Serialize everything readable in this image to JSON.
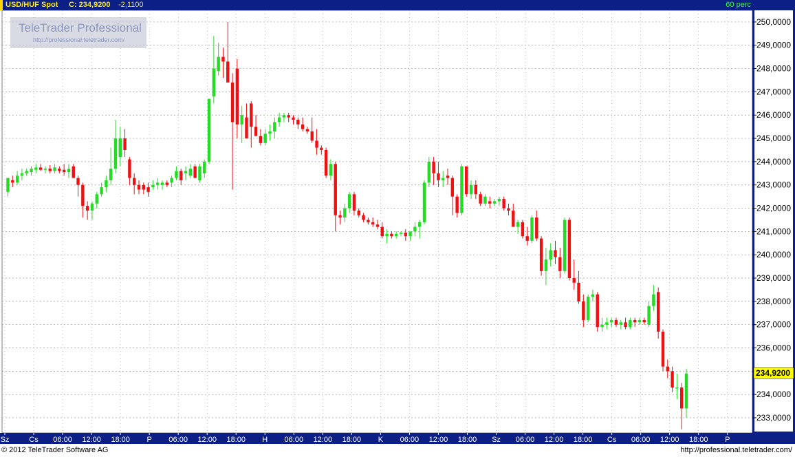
{
  "header": {
    "symbol": "USD/HUF Spot",
    "close_label": "C: 234,9200",
    "change": "-2,1100",
    "period": "60 perc"
  },
  "logo": {
    "brand": "TeleTrader Professional",
    "url": "http://professional.teletrader.com/"
  },
  "footer": {
    "copyright": "© 2012 TeleTrader Software AG",
    "url": "http://professional.teletrader.com/"
  },
  "colors": {
    "up": "#22dd22",
    "down": "#ee1111",
    "grid": "#9a9a9a",
    "header_bg": "#0b1f86",
    "axis_bg": "#0b1f86",
    "price_marker": "#ffff00"
  },
  "chart_data": {
    "type": "candlestick",
    "title": "USD/HUF Spot",
    "ylim": [
      232.35,
      250.5
    ],
    "y_ticks": [
      "233,0000",
      "234,0000",
      "235,0000",
      "236,0000",
      "237,0000",
      "238,0000",
      "239,0000",
      "240,0000",
      "241,0000",
      "242,0000",
      "243,0000",
      "244,0000",
      "245,0000",
      "246,0000",
      "247,0000",
      "248,0000",
      "249,0000",
      "250,0000"
    ],
    "last_price_label": "234,9200",
    "last_price": 234.92,
    "x_ticks": [
      "Sz",
      "Cs",
      "06:00",
      "12:00",
      "18:00",
      "P",
      "06:00",
      "12:00",
      "18:00",
      "H",
      "06:00",
      "12:00",
      "18:00",
      "K",
      "06:00",
      "12:00",
      "18:00",
      "Sz",
      "06:00",
      "12:00",
      "18:00",
      "Cs",
      "06:00",
      "12:00",
      "18:00",
      "P"
    ],
    "grid": true,
    "candles": [
      {
        "o": 242.7,
        "h": 243.3,
        "l": 242.5,
        "c": 243.3
      },
      {
        "o": 243.2,
        "h": 243.4,
        "l": 242.9,
        "c": 243.1
      },
      {
        "o": 243.1,
        "h": 243.6,
        "l": 243.0,
        "c": 243.4
      },
      {
        "o": 243.4,
        "h": 243.7,
        "l": 243.2,
        "c": 243.5
      },
      {
        "o": 243.5,
        "h": 243.7,
        "l": 243.4,
        "c": 243.6
      },
      {
        "o": 243.55,
        "h": 243.8,
        "l": 243.4,
        "c": 243.7
      },
      {
        "o": 243.65,
        "h": 243.9,
        "l": 243.5,
        "c": 243.75
      },
      {
        "o": 243.75,
        "h": 243.9,
        "l": 243.6,
        "c": 243.65
      },
      {
        "o": 243.65,
        "h": 243.8,
        "l": 243.5,
        "c": 243.7
      },
      {
        "o": 243.7,
        "h": 243.85,
        "l": 243.5,
        "c": 243.6
      },
      {
        "o": 243.6,
        "h": 243.9,
        "l": 243.5,
        "c": 243.75
      },
      {
        "o": 243.7,
        "h": 243.8,
        "l": 243.5,
        "c": 243.6
      },
      {
        "o": 243.65,
        "h": 243.9,
        "l": 243.4,
        "c": 243.55
      },
      {
        "o": 243.55,
        "h": 243.9,
        "l": 243.3,
        "c": 243.7
      },
      {
        "o": 243.8,
        "h": 243.9,
        "l": 243.3,
        "c": 243.3
      },
      {
        "o": 243.3,
        "h": 243.4,
        "l": 242.5,
        "c": 243.0
      },
      {
        "o": 243.0,
        "h": 243.1,
        "l": 241.6,
        "c": 242.1
      },
      {
        "o": 242.1,
        "h": 242.3,
        "l": 241.5,
        "c": 241.9
      },
      {
        "o": 241.9,
        "h": 242.3,
        "l": 241.5,
        "c": 242.2
      },
      {
        "o": 242.2,
        "h": 242.7,
        "l": 242.0,
        "c": 242.6
      },
      {
        "o": 242.6,
        "h": 243.1,
        "l": 242.5,
        "c": 242.9
      },
      {
        "o": 242.9,
        "h": 243.4,
        "l": 242.7,
        "c": 243.2
      },
      {
        "o": 243.2,
        "h": 244.6,
        "l": 243.0,
        "c": 243.7
      },
      {
        "o": 243.7,
        "h": 245.8,
        "l": 243.5,
        "c": 245.0
      },
      {
        "o": 244.2,
        "h": 245.5,
        "l": 243.8,
        "c": 245.0
      },
      {
        "o": 245.0,
        "h": 245.4,
        "l": 244.2,
        "c": 244.5
      },
      {
        "o": 244.1,
        "h": 244.2,
        "l": 243.0,
        "c": 243.3
      },
      {
        "o": 243.3,
        "h": 243.5,
        "l": 242.6,
        "c": 243.0
      },
      {
        "o": 243.0,
        "h": 243.2,
        "l": 242.6,
        "c": 242.8
      },
      {
        "o": 243.0,
        "h": 243.1,
        "l": 242.6,
        "c": 242.8
      },
      {
        "o": 242.9,
        "h": 243.1,
        "l": 242.5,
        "c": 242.7
      },
      {
        "o": 242.9,
        "h": 243.2,
        "l": 242.8,
        "c": 243.0
      },
      {
        "o": 243.0,
        "h": 243.3,
        "l": 242.8,
        "c": 243.1
      },
      {
        "o": 243.0,
        "h": 243.2,
        "l": 242.8,
        "c": 243.1
      },
      {
        "o": 243.1,
        "h": 243.2,
        "l": 242.9,
        "c": 243.0
      },
      {
        "o": 243.1,
        "h": 243.4,
        "l": 242.9,
        "c": 243.3
      },
      {
        "o": 243.3,
        "h": 243.8,
        "l": 243.2,
        "c": 243.6
      },
      {
        "o": 243.6,
        "h": 243.7,
        "l": 243.0,
        "c": 243.2
      },
      {
        "o": 243.5,
        "h": 243.8,
        "l": 243.2,
        "c": 243.6
      },
      {
        "o": 243.4,
        "h": 243.9,
        "l": 243.3,
        "c": 243.7
      },
      {
        "o": 243.8,
        "h": 243.9,
        "l": 243.3,
        "c": 243.3
      },
      {
        "o": 243.2,
        "h": 243.9,
        "l": 243.1,
        "c": 243.8
      },
      {
        "o": 243.5,
        "h": 244.1,
        "l": 243.3,
        "c": 244.0
      },
      {
        "o": 244.0,
        "h": 246.7,
        "l": 243.9,
        "c": 246.7
      },
      {
        "o": 246.8,
        "h": 249.4,
        "l": 246.5,
        "c": 248.0
      },
      {
        "o": 247.9,
        "h": 249.1,
        "l": 247.7,
        "c": 248.5
      },
      {
        "o": 248.5,
        "h": 248.9,
        "l": 247.6,
        "c": 248.3
      },
      {
        "o": 248.3,
        "h": 250.0,
        "l": 247.5,
        "c": 247.4
      },
      {
        "o": 247.4,
        "h": 247.8,
        "l": 242.8,
        "c": 245.7
      },
      {
        "o": 248.0,
        "h": 248.4,
        "l": 245.0,
        "c": 245.6
      },
      {
        "o": 245.6,
        "h": 246.4,
        "l": 244.8,
        "c": 246.0
      },
      {
        "o": 245.9,
        "h": 246.5,
        "l": 245.1,
        "c": 245.0
      },
      {
        "o": 246.5,
        "h": 246.6,
        "l": 244.6,
        "c": 245.5
      },
      {
        "o": 245.5,
        "h": 246.0,
        "l": 245.3,
        "c": 245.1
      },
      {
        "o": 245.1,
        "h": 245.4,
        "l": 244.7,
        "c": 244.8
      },
      {
        "o": 244.8,
        "h": 245.4,
        "l": 244.7,
        "c": 245.2
      },
      {
        "o": 245.2,
        "h": 245.6,
        "l": 244.9,
        "c": 245.3
      },
      {
        "o": 245.3,
        "h": 245.9,
        "l": 245.0,
        "c": 245.7
      },
      {
        "o": 245.7,
        "h": 246.1,
        "l": 245.5,
        "c": 245.9
      },
      {
        "o": 245.9,
        "h": 246.1,
        "l": 245.7,
        "c": 246.0
      },
      {
        "o": 246.0,
        "h": 246.1,
        "l": 245.7,
        "c": 245.9
      },
      {
        "o": 245.9,
        "h": 246.0,
        "l": 245.6,
        "c": 245.8
      },
      {
        "o": 245.8,
        "h": 245.9,
        "l": 245.4,
        "c": 245.6
      },
      {
        "o": 245.6,
        "h": 245.9,
        "l": 245.3,
        "c": 245.4
      },
      {
        "o": 245.4,
        "h": 245.5,
        "l": 245.2,
        "c": 245.3
      },
      {
        "o": 245.3,
        "h": 245.9,
        "l": 244.8,
        "c": 244.9
      },
      {
        "o": 244.9,
        "h": 245.4,
        "l": 244.3,
        "c": 244.6
      },
      {
        "o": 244.6,
        "h": 244.7,
        "l": 244.3,
        "c": 244.5
      },
      {
        "o": 244.5,
        "h": 244.6,
        "l": 243.3,
        "c": 243.4
      },
      {
        "o": 243.4,
        "h": 244.1,
        "l": 243.2,
        "c": 243.9
      },
      {
        "o": 243.9,
        "h": 244.0,
        "l": 241.0,
        "c": 241.7
      },
      {
        "o": 241.7,
        "h": 241.9,
        "l": 241.3,
        "c": 241.6
      },
      {
        "o": 241.6,
        "h": 242.2,
        "l": 241.4,
        "c": 242.0
      },
      {
        "o": 242.0,
        "h": 242.7,
        "l": 241.8,
        "c": 242.6
      },
      {
        "o": 242.6,
        "h": 242.7,
        "l": 241.7,
        "c": 241.9
      },
      {
        "o": 241.9,
        "h": 242.0,
        "l": 241.6,
        "c": 241.7
      },
      {
        "o": 241.7,
        "h": 241.8,
        "l": 241.4,
        "c": 241.5
      },
      {
        "o": 241.5,
        "h": 241.6,
        "l": 241.3,
        "c": 241.4
      },
      {
        "o": 241.4,
        "h": 241.6,
        "l": 241.2,
        "c": 241.3
      },
      {
        "o": 241.3,
        "h": 241.5,
        "l": 241.1,
        "c": 241.2
      },
      {
        "o": 241.2,
        "h": 241.4,
        "l": 240.7,
        "c": 240.8
      },
      {
        "o": 240.8,
        "h": 241.1,
        "l": 240.5,
        "c": 240.9
      },
      {
        "o": 240.9,
        "h": 241.0,
        "l": 240.7,
        "c": 240.8
      },
      {
        "o": 240.8,
        "h": 241.0,
        "l": 240.7,
        "c": 240.9
      },
      {
        "o": 240.9,
        "h": 241.0,
        "l": 240.8,
        "c": 240.95
      },
      {
        "o": 240.95,
        "h": 241.1,
        "l": 240.6,
        "c": 240.8
      },
      {
        "o": 240.8,
        "h": 241.0,
        "l": 240.6,
        "c": 241.0
      },
      {
        "o": 241.0,
        "h": 241.4,
        "l": 240.8,
        "c": 241.2
      },
      {
        "o": 241.2,
        "h": 241.5,
        "l": 240.7,
        "c": 241.4
      },
      {
        "o": 241.4,
        "h": 243.2,
        "l": 241.3,
        "c": 243.1
      },
      {
        "o": 243.1,
        "h": 244.2,
        "l": 242.9,
        "c": 244.0
      },
      {
        "o": 244.0,
        "h": 244.2,
        "l": 243.0,
        "c": 243.5
      },
      {
        "o": 243.5,
        "h": 244.0,
        "l": 242.9,
        "c": 243.2
      },
      {
        "o": 243.2,
        "h": 243.6,
        "l": 242.9,
        "c": 243.3
      },
      {
        "o": 243.4,
        "h": 243.7,
        "l": 243.0,
        "c": 243.3
      },
      {
        "o": 243.3,
        "h": 243.4,
        "l": 241.7,
        "c": 242.5
      },
      {
        "o": 242.5,
        "h": 242.6,
        "l": 241.6,
        "c": 241.8
      },
      {
        "o": 241.8,
        "h": 243.9,
        "l": 241.7,
        "c": 243.8
      },
      {
        "o": 243.8,
        "h": 243.8,
        "l": 242.5,
        "c": 242.6
      },
      {
        "o": 242.6,
        "h": 243.2,
        "l": 242.4,
        "c": 243.0
      },
      {
        "o": 243.0,
        "h": 243.2,
        "l": 242.4,
        "c": 242.6
      },
      {
        "o": 242.6,
        "h": 242.7,
        "l": 242.1,
        "c": 242.2
      },
      {
        "o": 242.2,
        "h": 242.6,
        "l": 242.1,
        "c": 242.5
      },
      {
        "o": 242.3,
        "h": 242.5,
        "l": 242.0,
        "c": 242.2
      },
      {
        "o": 242.2,
        "h": 242.4,
        "l": 242.1,
        "c": 242.3
      },
      {
        "o": 242.3,
        "h": 242.5,
        "l": 242.1,
        "c": 242.4
      },
      {
        "o": 242.4,
        "h": 242.5,
        "l": 241.9,
        "c": 242.0
      },
      {
        "o": 242.0,
        "h": 242.2,
        "l": 241.7,
        "c": 241.9
      },
      {
        "o": 241.9,
        "h": 242.2,
        "l": 241.2,
        "c": 241.2
      },
      {
        "o": 241.2,
        "h": 241.5,
        "l": 240.9,
        "c": 241.4
      },
      {
        "o": 241.4,
        "h": 241.5,
        "l": 240.7,
        "c": 240.8
      },
      {
        "o": 240.8,
        "h": 241.2,
        "l": 240.4,
        "c": 240.6
      },
      {
        "o": 240.6,
        "h": 241.7,
        "l": 240.5,
        "c": 241.6
      },
      {
        "o": 241.6,
        "h": 241.9,
        "l": 240.6,
        "c": 240.7
      },
      {
        "o": 240.7,
        "h": 240.8,
        "l": 239.1,
        "c": 239.3
      },
      {
        "o": 239.3,
        "h": 240.3,
        "l": 238.7,
        "c": 239.8
      },
      {
        "o": 239.8,
        "h": 240.5,
        "l": 239.5,
        "c": 240.2
      },
      {
        "o": 240.2,
        "h": 240.6,
        "l": 239.6,
        "c": 239.9
      },
      {
        "o": 239.9,
        "h": 240.3,
        "l": 239.0,
        "c": 239.3
      },
      {
        "o": 239.3,
        "h": 241.6,
        "l": 239.2,
        "c": 241.5
      },
      {
        "o": 241.5,
        "h": 241.6,
        "l": 238.9,
        "c": 239.0
      },
      {
        "o": 239.0,
        "h": 239.8,
        "l": 238.5,
        "c": 238.8
      },
      {
        "o": 238.8,
        "h": 239.3,
        "l": 237.9,
        "c": 238.0
      },
      {
        "o": 238.0,
        "h": 238.3,
        "l": 236.9,
        "c": 237.2
      },
      {
        "o": 237.2,
        "h": 238.3,
        "l": 237.1,
        "c": 238.2
      },
      {
        "o": 238.2,
        "h": 238.5,
        "l": 238.0,
        "c": 238.3
      },
      {
        "o": 238.3,
        "h": 238.4,
        "l": 236.7,
        "c": 236.9
      },
      {
        "o": 236.9,
        "h": 237.3,
        "l": 236.7,
        "c": 237.0
      },
      {
        "o": 237.0,
        "h": 237.3,
        "l": 236.8,
        "c": 237.1
      },
      {
        "o": 237.1,
        "h": 237.3,
        "l": 236.9,
        "c": 237.2
      },
      {
        "o": 237.2,
        "h": 237.3,
        "l": 236.9,
        "c": 237.0
      },
      {
        "o": 237.0,
        "h": 237.2,
        "l": 236.8,
        "c": 237.1
      },
      {
        "o": 237.1,
        "h": 237.3,
        "l": 236.8,
        "c": 236.9
      },
      {
        "o": 236.9,
        "h": 237.3,
        "l": 236.8,
        "c": 237.2
      },
      {
        "o": 237.2,
        "h": 237.3,
        "l": 236.9,
        "c": 237.1
      },
      {
        "o": 237.1,
        "h": 237.3,
        "l": 237.0,
        "c": 237.2
      },
      {
        "o": 237.2,
        "h": 237.3,
        "l": 237.0,
        "c": 237.1
      },
      {
        "o": 237.0,
        "h": 238.0,
        "l": 236.9,
        "c": 237.8
      },
      {
        "o": 237.8,
        "h": 238.7,
        "l": 237.6,
        "c": 238.3
      },
      {
        "o": 238.4,
        "h": 238.6,
        "l": 236.4,
        "c": 236.7
      },
      {
        "o": 236.7,
        "h": 236.8,
        "l": 235.0,
        "c": 235.2
      },
      {
        "o": 235.2,
        "h": 235.5,
        "l": 234.7,
        "c": 235.0
      },
      {
        "o": 235.0,
        "h": 235.2,
        "l": 234.1,
        "c": 234.3
      },
      {
        "o": 234.3,
        "h": 234.9,
        "l": 233.8,
        "c": 234.3
      },
      {
        "o": 234.3,
        "h": 234.5,
        "l": 232.5,
        "c": 233.4
      },
      {
        "o": 233.4,
        "h": 235.1,
        "l": 233.0,
        "c": 234.9
      }
    ]
  }
}
